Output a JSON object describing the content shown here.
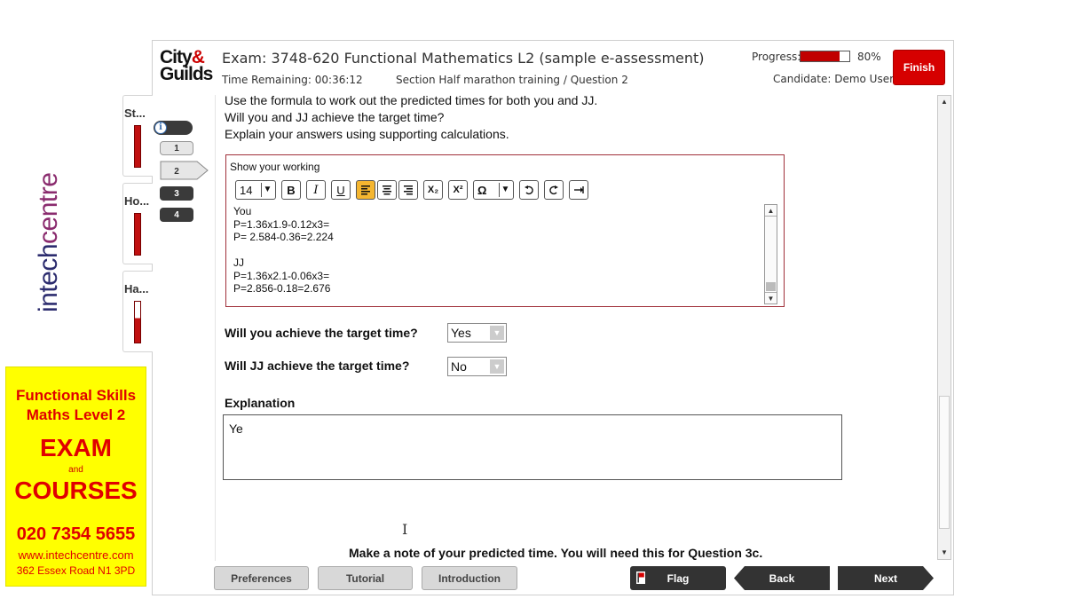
{
  "branding": {
    "logo_text_a": "intech",
    "logo_text_b": "centre",
    "promo_line1": "Functional Skills",
    "promo_line2": "Maths Level 2",
    "promo_exam": "EXAM",
    "promo_and": "and",
    "promo_courses": "COURSES",
    "promo_phone": "020 7354 5655",
    "promo_web": "www.intechcentre.com",
    "promo_address": "362 Essex Road N1 3PD"
  },
  "header": {
    "logo_line1": "City",
    "logo_amp": "&",
    "logo_line2": "Guilds",
    "exam_title": "Exam: 3748-620 Functional Mathematics L2 (sample e-assessment)",
    "time_remaining_label": "Time Remaining:  00:36:12",
    "section_label": "Section Half marathon training / Question 2",
    "progress_label": "Progress:",
    "progress_value": 0.8,
    "progress_pct": "80%",
    "candidate": "Candidate: Demo User",
    "finish_label": "Finish"
  },
  "sections": [
    {
      "label": "St..."
    },
    {
      "label": "Ho..."
    },
    {
      "label": "Ha..."
    }
  ],
  "question_nav": [
    "1",
    "2",
    "3",
    "4"
  ],
  "question": {
    "line1": "Use the formula to work out the predicted times for both you and JJ.",
    "line2": "Will you and JJ achieve the target time?",
    "line3": "Explain your answers using supporting calculations.",
    "working_title": "Show your working",
    "font_size": "14",
    "working_text": "You\nP=1.36x1.9-0.12x3=\nP= 2.584-0.36=2.224\n\nJJ\nP=1.36x2.1-0.06x3=\nP=2.856-0.18=2.676",
    "q_you": "Will you achieve the target time?",
    "q_you_answer": "Yes",
    "q_jj": "Will JJ achieve the target time?",
    "q_jj_answer": "No",
    "explanation_label": "Explanation",
    "explanation_text": "Ye",
    "note": "Make a note of your predicted time. You will need this for Question 3c."
  },
  "toolbar": {
    "bold": "B",
    "italic": "I",
    "underline": "U",
    "subscript": "X₂",
    "superscript": "X²",
    "omega": "Ω"
  },
  "footer": {
    "preferences": "Preferences",
    "tutorial": "Tutorial",
    "introduction": "Introduction",
    "flag": "Flag",
    "back": "Back",
    "next": "Next"
  },
  "colors": {
    "finish_red": "#d60000",
    "progress_red": "#c00000",
    "promo_yellow": "#ffff00",
    "promo_red": "#e00000",
    "active_tool": "#f5b630"
  }
}
